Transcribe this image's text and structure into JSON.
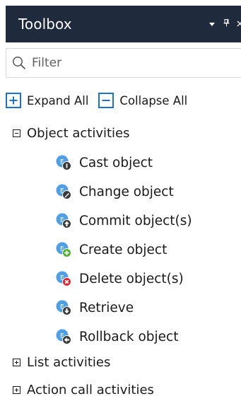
{
  "panel": {
    "title": "Toolbox",
    "controls": {
      "dropdown": "▼",
      "pin": "⌖",
      "close": "×"
    }
  },
  "search": {
    "placeholder": "Filter",
    "value": ""
  },
  "toolbar": {
    "expand_label": "Expand All",
    "collapse_label": "Collapse All"
  },
  "tree": {
    "groups": [
      {
        "label": "Object activities",
        "expanded": true,
        "items": [
          {
            "label": "Cast object",
            "badge": "cast",
            "badge_color": "#3a3a3a"
          },
          {
            "label": "Change object",
            "badge": "change",
            "badge_color": "#3a3a3a"
          },
          {
            "label": "Commit object(s)",
            "badge": "commit",
            "badge_color": "#3a3a3a"
          },
          {
            "label": "Create object",
            "badge": "create",
            "badge_color": "#4caf2e"
          },
          {
            "label": "Delete object(s)",
            "badge": "delete",
            "badge_color": "#e0262d"
          },
          {
            "label": "Retrieve",
            "badge": "retrieve",
            "badge_color": "#3a3a3a"
          },
          {
            "label": "Rollback object",
            "badge": "rollback",
            "badge_color": "#3a3a3a"
          }
        ]
      },
      {
        "label": "List activities",
        "expanded": false
      },
      {
        "label": "Action call activities",
        "expanded": false
      }
    ]
  },
  "colors": {
    "titlebar_bg": "#1f2b3c",
    "accent_blue": "#1a73c9",
    "icon_blue": "#4f9fe6"
  }
}
